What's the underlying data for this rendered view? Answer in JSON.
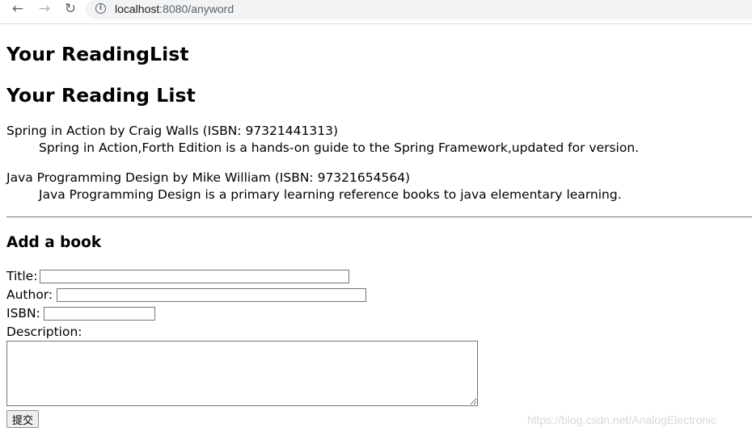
{
  "browser": {
    "back_icon": "←",
    "forward_icon": "→",
    "reload_icon": "↻",
    "info_icon": "i",
    "url_host": "localhost",
    "url_path": ":8080/anyword"
  },
  "page": {
    "app_title": "Your ReadingList",
    "list_heading": "Your Reading List",
    "books": [
      {
        "header": "Spring in Action by Craig Walls (ISBN: 97321441313)",
        "description": "Spring in Action,Forth Edition is a hands-on guide to the Spring Framework,updated for version."
      },
      {
        "header": "Java Programming Design by Mike William (ISBN: 97321654564)",
        "description": "Java Programming Design is a primary learning reference books to java elementary learning."
      }
    ]
  },
  "form": {
    "heading": "Add a book",
    "title_label": "Title:",
    "title_value": "",
    "author_label": "Author:",
    "author_value": "",
    "isbn_label": "ISBN:",
    "isbn_value": "",
    "description_label": "Description:",
    "description_value": "",
    "submit_label": "提交"
  },
  "watermark": "https://blog.csdn.net/AnalogElectronic"
}
